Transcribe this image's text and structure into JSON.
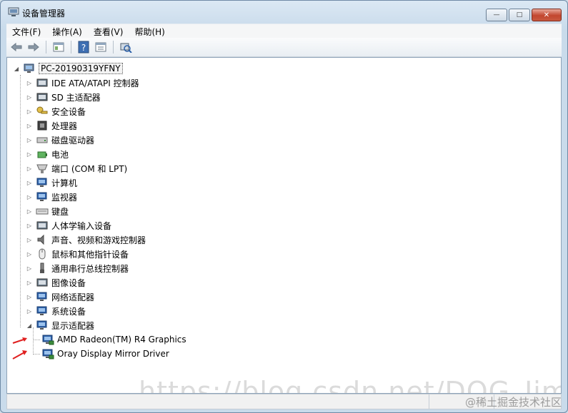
{
  "window": {
    "title": "设备管理器",
    "caption": {
      "minimize": "—",
      "maximize": "□",
      "close": "✕"
    }
  },
  "menu": [
    {
      "label": "文件(F)"
    },
    {
      "label": "操作(A)"
    },
    {
      "label": "查看(V)"
    },
    {
      "label": "帮助(H)"
    }
  ],
  "toolbar": {
    "icons": [
      "back-arrow-icon",
      "forward-arrow-icon",
      "properties-icon",
      "help-icon",
      "view-icon",
      "scan-hardware-icon"
    ]
  },
  "tree": {
    "root": "PC-20190319YFNY",
    "categories": [
      {
        "label": "IDE ATA/ATAPI 控制器",
        "icon": "ide-controller-icon",
        "color": "#6a7a88"
      },
      {
        "label": "SD 主适配器",
        "icon": "sd-adapter-icon",
        "color": "#5a6772"
      },
      {
        "label": "安全设备",
        "icon": "security-key-icon",
        "color": "#caa32a"
      },
      {
        "label": "处理器",
        "icon": "processor-icon",
        "color": "#555"
      },
      {
        "label": "磁盘驱动器",
        "icon": "disk-drive-icon",
        "color": "#8a9199"
      },
      {
        "label": "电池",
        "icon": "battery-icon",
        "color": "#3c9a3c"
      },
      {
        "label": "端口 (COM 和 LPT)",
        "icon": "port-icon",
        "color": "#8a8f95"
      },
      {
        "label": "计算机",
        "icon": "computer-icon",
        "color": "#2b5fa8"
      },
      {
        "label": "监视器",
        "icon": "monitor-icon",
        "color": "#2b5fa8"
      },
      {
        "label": "键盘",
        "icon": "keyboard-icon",
        "color": "#8a8f95"
      },
      {
        "label": "人体学输入设备",
        "icon": "hid-icon",
        "color": "#6a7a88"
      },
      {
        "label": "声音、视频和游戏控制器",
        "icon": "speaker-icon",
        "color": "#6a7a88"
      },
      {
        "label": "鼠标和其他指针设备",
        "icon": "mouse-icon",
        "color": "#8a8f95"
      },
      {
        "label": "通用串行总线控制器",
        "icon": "usb-icon",
        "color": "#6a7a88"
      },
      {
        "label": "图像设备",
        "icon": "camera-icon",
        "color": "#6a7a88"
      },
      {
        "label": "网络适配器",
        "icon": "network-adapter-icon",
        "color": "#2b5fa8"
      },
      {
        "label": "系统设备",
        "icon": "system-device-icon",
        "color": "#2b5fa8"
      },
      {
        "label": "显示适配器",
        "icon": "display-adapter-icon",
        "color": "#2b5fa8",
        "expanded": true
      }
    ],
    "display_children": [
      {
        "label": "AMD Radeon(TM) R4 Graphics"
      },
      {
        "label": "Oray Display Mirror Driver"
      }
    ]
  },
  "watermark": "https://blog.csdn.net/DOG_Jimmy",
  "corner_watermark": "@稀土掘金技术社区",
  "colors": {
    "annotation_arrow": "#e02020"
  }
}
